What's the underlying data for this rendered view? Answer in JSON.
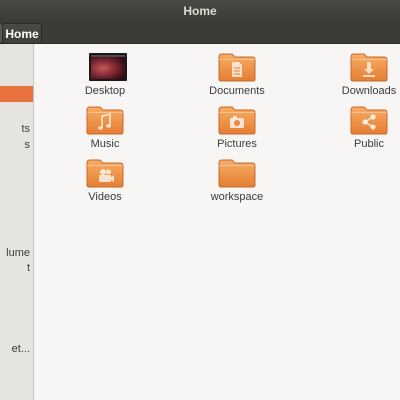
{
  "window": {
    "title": "Home"
  },
  "pathbar": {
    "current": "Home"
  },
  "sidebar": {
    "items": [
      {
        "label": "ts"
      },
      {
        "label": "s"
      },
      {
        "label": "lume"
      },
      {
        "label": "t"
      },
      {
        "label": "et..."
      }
    ]
  },
  "files": [
    {
      "label": "Desktop",
      "icon": "desktop-thumbnail"
    },
    {
      "label": "Documents",
      "icon": "folder-documents-icon"
    },
    {
      "label": "Downloads",
      "icon": "folder-downloads-icon"
    },
    {
      "label": "Music",
      "icon": "folder-music-icon"
    },
    {
      "label": "Pictures",
      "icon": "folder-pictures-icon"
    },
    {
      "label": "Public",
      "icon": "folder-public-icon"
    },
    {
      "label": "Videos",
      "icon": "folder-videos-icon"
    },
    {
      "label": "workspace",
      "icon": "folder-icon"
    }
  ],
  "colors": {
    "accent": "#e9713e",
    "folder": "#f39a4f",
    "titlebar": "#3c3b37"
  }
}
